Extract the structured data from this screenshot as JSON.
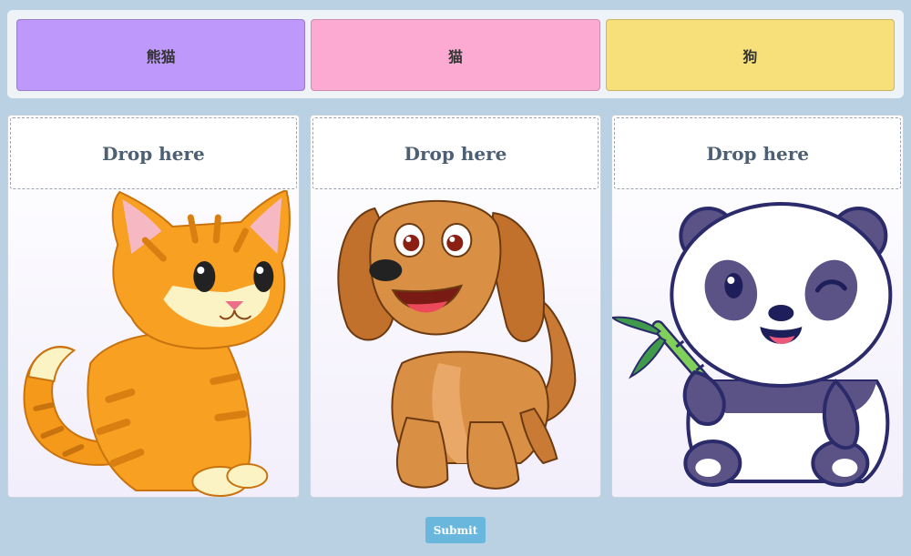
{
  "word_bank": {
    "chips": [
      {
        "label": "熊猫",
        "color": "#bf98fb"
      },
      {
        "label": "猫",
        "color": "#fdaad3"
      },
      {
        "label": "狗",
        "color": "#f7df79"
      }
    ]
  },
  "cards": [
    {
      "drop_label": "Drop here",
      "image": "cartoon-cat"
    },
    {
      "drop_label": "Drop here",
      "image": "cartoon-dog"
    },
    {
      "drop_label": "Drop here",
      "image": "cartoon-panda"
    }
  ],
  "submit": {
    "label": "Submit"
  }
}
